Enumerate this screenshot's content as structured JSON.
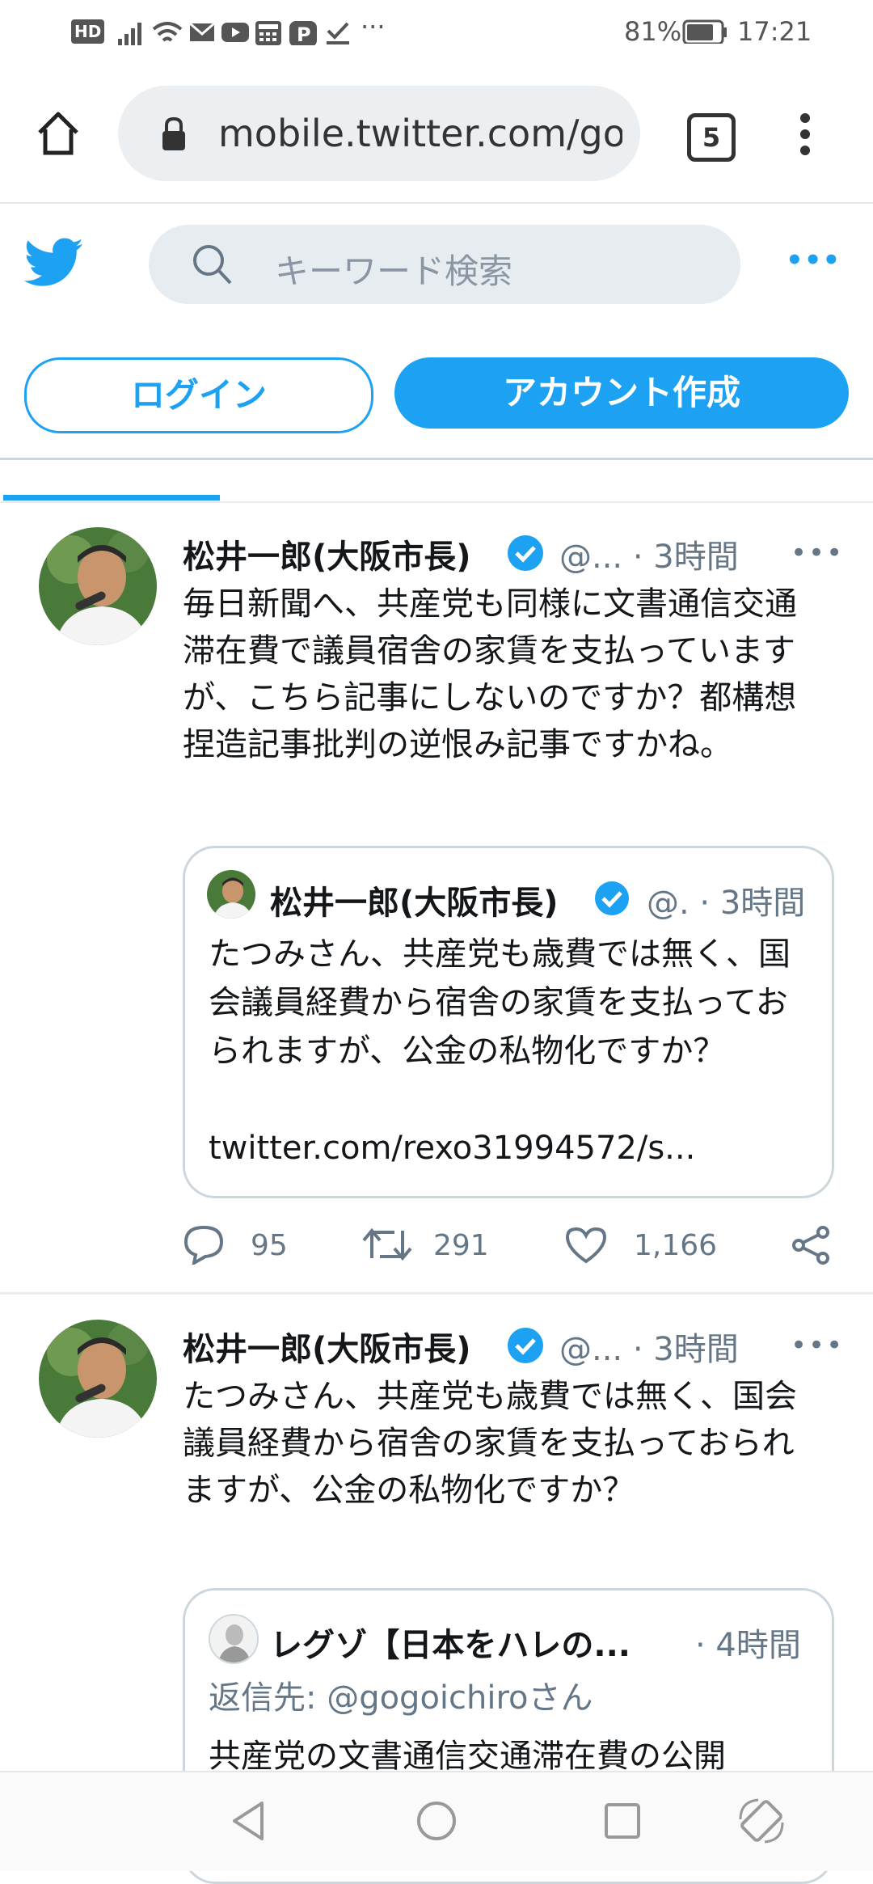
{
  "status_bar": {
    "hd_label": "HD",
    "battery": "81%",
    "time": "17:21",
    "dots": "···"
  },
  "browser": {
    "url": "mobile.twitter.com/gogoichiro",
    "tab_count": "5"
  },
  "header": {
    "search_placeholder": "キーワード検索",
    "more": "•••",
    "login_label": "ログイン",
    "signup_label": "アカウント作成"
  },
  "tweets": [
    {
      "name": "松井一郎(大阪市長)",
      "handle": "@... · 3時間",
      "more": "•••",
      "body": "毎日新聞へ、共産党も同様に文書通信交通滞在費で議員宿舎の家賃を支払っていますが、こちら記事にしないのですか？都構想捏造記事批判の逆恨み記事ですかね。",
      "quote": {
        "name": "松井一郎(大阪市長)",
        "handle": "@. · 3時間",
        "body": "たつみさん、共産党も歳費では無く、国会議員経費から宿舎の家賃を支払っておられますが、公金の私物化ですか？",
        "link": "twitter.com/rexo31994572/s..."
      },
      "replies": "95",
      "retweets": "291",
      "likes": "1,166"
    },
    {
      "name": "松井一郎(大阪市長)",
      "handle": "@... · 3時間",
      "more": "•••",
      "body": "たつみさん、共産党も歳費では無く、国会議員経費から宿舎の家賃を支払っておられますが、公金の私物化ですか？",
      "quote": {
        "name": "レグゾ【日本をハレの...",
        "handle": "· 4時間",
        "reply_to": "返信先: @gogoichiroさん",
        "body": "共産党の文書通信交通滞在費の公開"
      }
    }
  ],
  "colors": {
    "accent": "#1da1f2",
    "text": "#14171a",
    "secondary": "#657786",
    "border": "#ccd6dd"
  }
}
